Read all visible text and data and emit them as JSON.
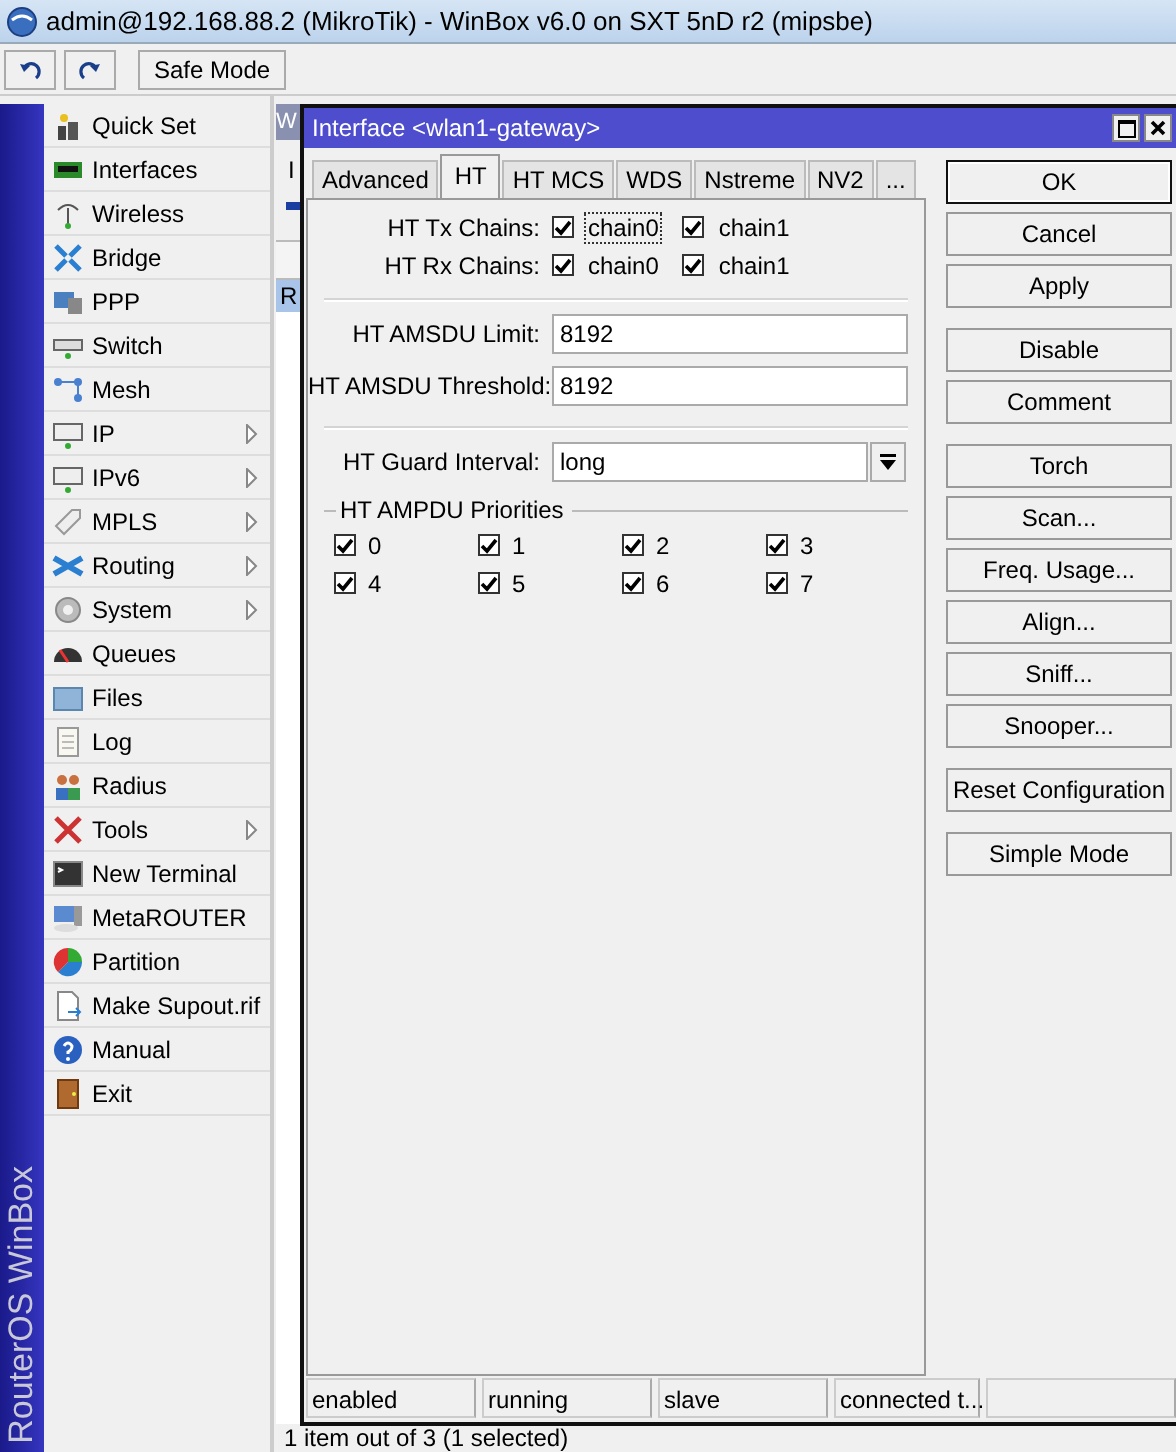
{
  "window": {
    "title": "admin@192.168.88.2 (MikroTik) - WinBox v6.0 on SXT 5nD r2 (mipsbe)"
  },
  "toolbar": {
    "safe_mode": "Safe Mode"
  },
  "side_label": "RouterOS WinBox",
  "menu": [
    {
      "label": "Quick Set",
      "submenu": false
    },
    {
      "label": "Interfaces",
      "submenu": false
    },
    {
      "label": "Wireless",
      "submenu": false
    },
    {
      "label": "Bridge",
      "submenu": false
    },
    {
      "label": "PPP",
      "submenu": false
    },
    {
      "label": "Switch",
      "submenu": false
    },
    {
      "label": "Mesh",
      "submenu": false
    },
    {
      "label": "IP",
      "submenu": true
    },
    {
      "label": "IPv6",
      "submenu": true
    },
    {
      "label": "MPLS",
      "submenu": true
    },
    {
      "label": "Routing",
      "submenu": true
    },
    {
      "label": "System",
      "submenu": true
    },
    {
      "label": "Queues",
      "submenu": false
    },
    {
      "label": "Files",
      "submenu": false
    },
    {
      "label": "Log",
      "submenu": false
    },
    {
      "label": "Radius",
      "submenu": false
    },
    {
      "label": "Tools",
      "submenu": true
    },
    {
      "label": "New Terminal",
      "submenu": false
    },
    {
      "label": "MetaROUTER",
      "submenu": false
    },
    {
      "label": "Partition",
      "submenu": false
    },
    {
      "label": "Make Supout.rif",
      "submenu": false
    },
    {
      "label": "Manual",
      "submenu": false
    },
    {
      "label": "Exit",
      "submenu": false
    }
  ],
  "background_window": {
    "title": "W",
    "tab": "I",
    "row": "R",
    "status": "1 item out of 3 (1 selected)"
  },
  "dialog": {
    "title": "Interface <wlan1-gateway>",
    "tabs": [
      {
        "label": "Advanced",
        "selected": false
      },
      {
        "label": "HT",
        "selected": true
      },
      {
        "label": "HT MCS",
        "selected": false
      },
      {
        "label": "WDS",
        "selected": false
      },
      {
        "label": "Nstreme",
        "selected": false
      },
      {
        "label": "NV2",
        "selected": false
      },
      {
        "label": "...",
        "selected": false
      }
    ],
    "chains": [
      {
        "label": "HT Tx Chains:",
        "options": [
          {
            "label": "chain0",
            "checked": true,
            "focused": true
          },
          {
            "label": "chain1",
            "checked": true,
            "focused": false
          }
        ]
      },
      {
        "label": "HT Rx Chains:",
        "options": [
          {
            "label": "chain0",
            "checked": true,
            "focused": false
          },
          {
            "label": "chain1",
            "checked": true,
            "focused": false
          }
        ]
      }
    ],
    "amsdu": [
      {
        "label": "HT AMSDU Limit:",
        "value": "8192"
      },
      {
        "label": "HT AMSDU Threshold:",
        "value": "8192"
      }
    ],
    "guard_interval": {
      "label": "HT Guard Interval:",
      "value": "long"
    },
    "ampdu": {
      "title": "HT AMPDU Priorities",
      "items": [
        {
          "label": "0",
          "checked": true
        },
        {
          "label": "1",
          "checked": true
        },
        {
          "label": "2",
          "checked": true
        },
        {
          "label": "3",
          "checked": true
        },
        {
          "label": "4",
          "checked": true
        },
        {
          "label": "5",
          "checked": true
        },
        {
          "label": "6",
          "checked": true
        },
        {
          "label": "7",
          "checked": true
        }
      ]
    },
    "button_groups": [
      [
        {
          "label": "OK",
          "default": true
        },
        {
          "label": "Cancel",
          "default": false
        },
        {
          "label": "Apply",
          "default": false
        }
      ],
      [
        {
          "label": "Disable",
          "default": false
        },
        {
          "label": "Comment",
          "default": false
        }
      ],
      [
        {
          "label": "Torch",
          "default": false
        },
        {
          "label": "Scan...",
          "default": false
        },
        {
          "label": "Freq. Usage...",
          "default": false
        },
        {
          "label": "Align...",
          "default": false
        },
        {
          "label": "Sniff...",
          "default": false
        },
        {
          "label": "Snooper...",
          "default": false
        }
      ],
      [
        {
          "label": "Reset Configuration",
          "default": false
        }
      ],
      [
        {
          "label": "Simple Mode",
          "default": false
        }
      ]
    ],
    "status": [
      "enabled",
      "running",
      "slave",
      "connected t..."
    ]
  }
}
